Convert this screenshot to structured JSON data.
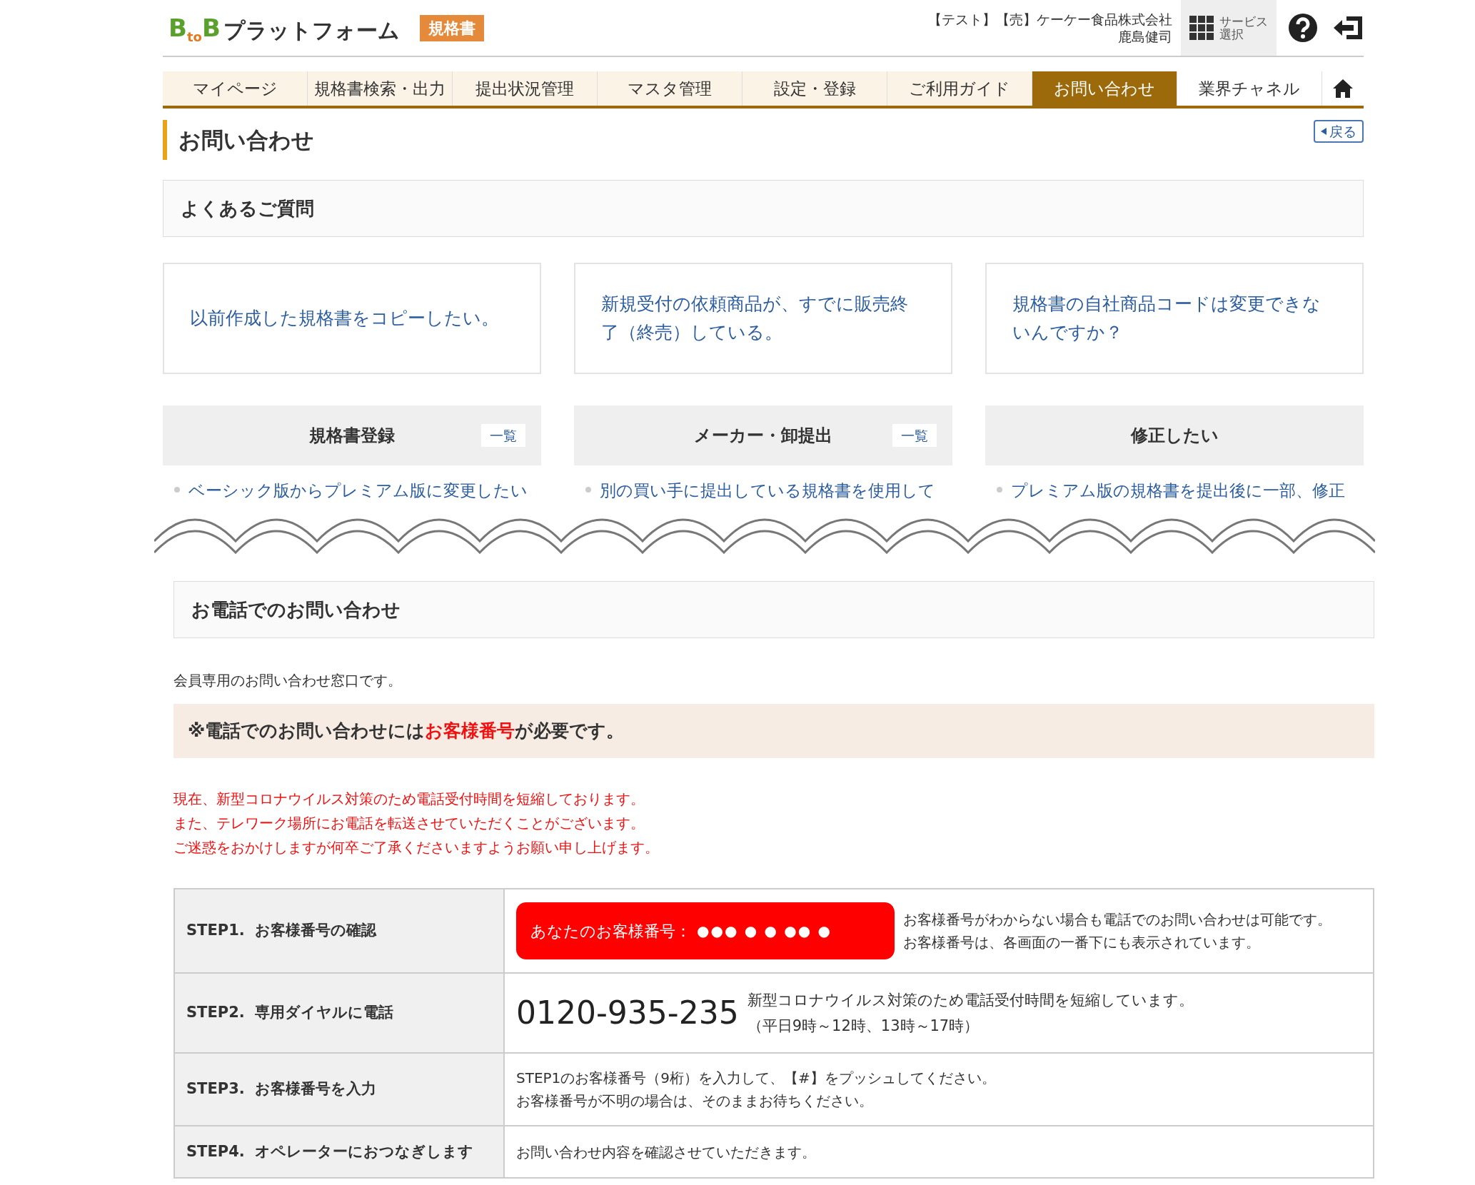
{
  "header": {
    "logo": {
      "letters": [
        "B",
        "to",
        "B"
      ],
      "name": "プラットフォーム",
      "badge": "規格書"
    },
    "user": [
      "【テスト】【売】ケーケー食品株式会社",
      "鹿島健司"
    ],
    "service": [
      "サービス",
      "選択"
    ]
  },
  "nav": [
    {
      "label": "マイページ",
      "selected": false
    },
    {
      "label": "規格書検索・出力",
      "selected": false
    },
    {
      "label": "提出状況管理",
      "selected": false
    },
    {
      "label": "マスタ管理",
      "selected": false
    },
    {
      "label": "設定・登録",
      "selected": false
    },
    {
      "label": "ご利用ガイド",
      "selected": false
    },
    {
      "label": "お問い合わせ",
      "selected": true
    },
    {
      "label": "業界チャネル",
      "selected": false
    }
  ],
  "page_title": "お問い合わせ",
  "back_button": "戻る",
  "faq": {
    "title": "よくあるご質問",
    "cards": [
      "以前作成した規格書をコピーしたい。",
      "新規受付の依頼商品が、すでに販売終了（終売）している。",
      "規格書の自社商品コードは変更できないんですか？"
    ],
    "categories": [
      {
        "title": "規格書登録",
        "link": "一覧",
        "item": "ベーシック版からプレミアム版に変更したい"
      },
      {
        "title": "メーカー・卸提出",
        "link": "一覧",
        "item": "別の買い手に提出している規格書を使用して"
      },
      {
        "title": "修正したい",
        "item": "プレミアム版の規格書を提出後に一部、修正"
      }
    ]
  },
  "phone": {
    "title": "お電話でのお問い合わせ",
    "intro": "会員専用のお問い合わせ窓口です。",
    "notice": "※電話でのお問い合わせには**お客様番号**が必要です。",
    "warnings": [
      "現在、新型コロナウイルス対策のため電話受付時間を短縮しております。",
      "また、テレワーク場所にお電話を転送させていただくことがございます。",
      "ご迷惑をおかけしますが何卒ご了承くださいますようお願い申し上げます。"
    ],
    "steps": [
      {
        "kind": "customer",
        "label": "STEP1.  お客様番号の確認",
        "badge_label": "あなたのお客様番号：",
        "badge_value": "●●● ● ● ●● ●",
        "notes": [
          "お客様番号がわからない場合も電話でのお問い合わせは可能です。",
          "お客様番号は、各画面の一番下にも表示されています。"
        ]
      },
      {
        "kind": "dial",
        "label": "STEP2.  専用ダイヤルに電話",
        "number": "0120-935-235",
        "notes": [
          "新型コロナウイルス対策のため電話受付時間を短縮しています。",
          "（平日9時～12時、13時～17時）"
        ]
      },
      {
        "kind": "text",
        "label": "STEP3.  お客様番号を入力",
        "notes": [
          "STEP1のお客様番号（9桁）を入力して、【#】をプッシュしてください。",
          "お客様番号が不明の場合は、そのままお待ちください。"
        ]
      },
      {
        "kind": "text",
        "label": "STEP4.  オペレーターにおつなぎします",
        "notes": [
          "お問い合わせ内容を確認させていただきます。"
        ]
      }
    ]
  }
}
